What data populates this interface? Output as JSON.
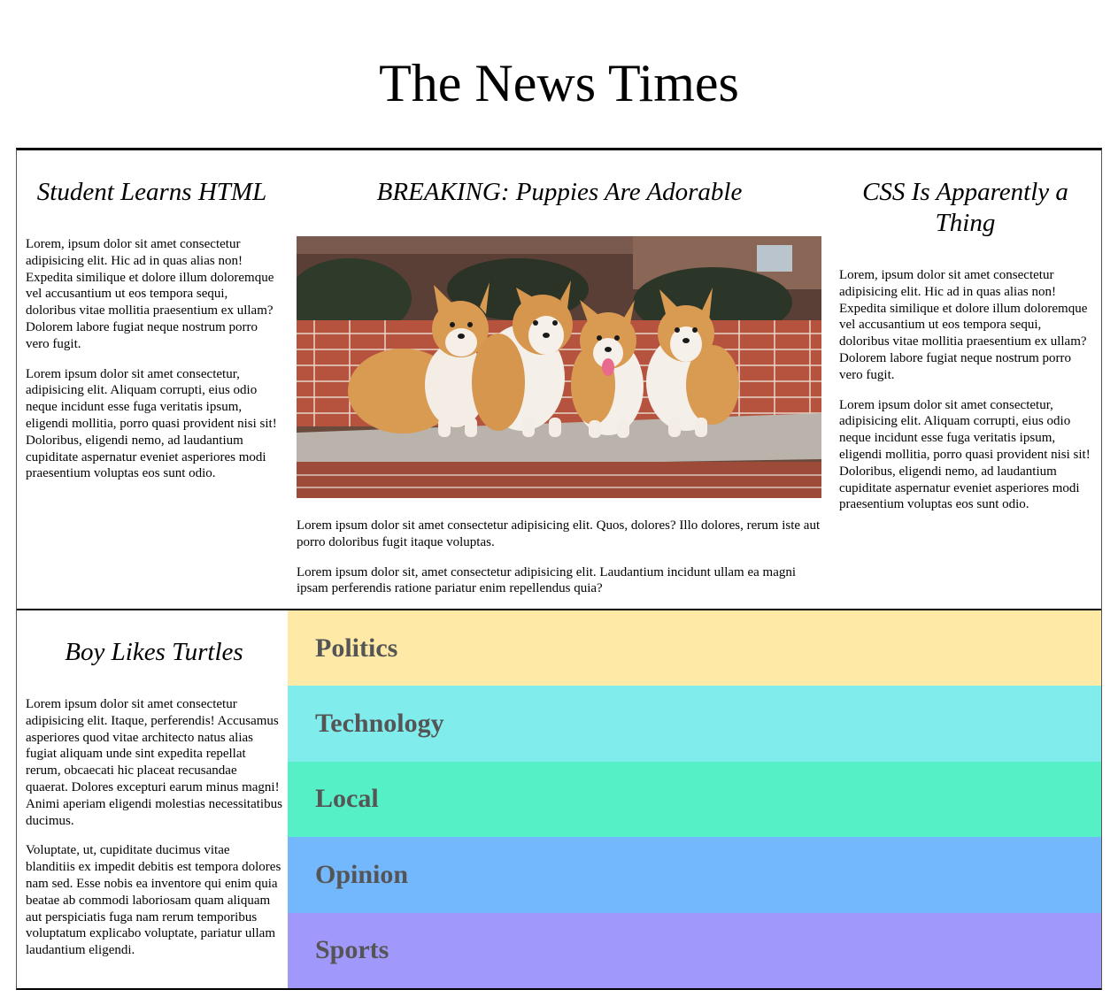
{
  "masthead": {
    "title": "The News Times"
  },
  "articles": {
    "left": {
      "headline": "Student Learns HTML",
      "paragraphs": [
        "Lorem, ipsum dolor sit amet consectetur adipisicing elit. Hic ad in quas alias non! Expedita similique et dolore illum doloremque vel accusantium ut eos tempora sequi, doloribus vitae mollitia praesentium ex ullam? Dolorem labore fugiat neque nostrum porro vero fugit.",
        "Lorem ipsum dolor sit amet consectetur, adipisicing elit. Aliquam corrupti, eius odio neque incidunt esse fuga veritatis ipsum, eligendi mollitia, porro quasi provident nisi sit! Doloribus, eligendi nemo, ad laudantium cupiditate aspernatur eveniet asperiores modi praesentium voluptas eos sunt odio."
      ]
    },
    "middle": {
      "headline": "BREAKING: Puppies Are Adorable",
      "image_subject": "four corgi puppies sitting on a brick ledge",
      "paragraphs": [
        "Lorem ipsum dolor sit amet consectetur adipisicing elit. Quos, dolores? Illo dolores, rerum iste aut porro doloribus fugit itaque voluptas.",
        "Lorem ipsum dolor sit, amet consectetur adipisicing elit. Laudantium incidunt ullam ea magni ipsam perferendis ratione pariatur enim repellendus quia?"
      ]
    },
    "right": {
      "headline": "CSS Is Apparently a Thing",
      "paragraphs": [
        "Lorem, ipsum dolor sit amet consectetur adipisicing elit. Hic ad in quas alias non! Expedita similique et dolore illum doloremque vel accusantium ut eos tempora sequi, doloribus vitae mollitia praesentium ex ullam? Dolorem labore fugiat neque nostrum porro vero fugit.",
        "Lorem ipsum dolor sit amet consectetur, adipisicing elit. Aliquam corrupti, eius odio neque incidunt esse fuga veritatis ipsum, eligendi mollitia, porro quasi provident nisi sit! Doloribus, eligendi nemo, ad laudantium cupiditate aspernatur eveniet asperiores modi praesentium voluptas eos sunt odio."
      ]
    },
    "bottom_left": {
      "headline": "Boy Likes Turtles",
      "paragraphs": [
        "Lorem ipsum dolor sit amet consectetur adipisicing elit. Itaque, perferendis! Accusamus asperiores quod vitae architecto natus alias fugiat aliquam unde sint expedita repellat rerum, obcaecati hic placeat recusandae quaerat. Dolores excepturi earum minus magni! Animi aperiam eligendi molestias necessitatibus ducimus.",
        "Voluptate, ut, cupiditate ducimus vitae blanditiis ex impedit debitis est tempora dolores nam sed. Esse nobis ea inventore qui enim quia beatae ab commodi laboriosam quam aliquam aut perspiciatis fuga nam rerum temporibus voluptatum explicabo voluptate, pariatur ullam laudantium eligendi."
      ]
    }
  },
  "categories": [
    {
      "label": "Politics",
      "color": "#ffe9a6"
    },
    {
      "label": "Technology",
      "color": "#80ecec"
    },
    {
      "label": "Local",
      "color": "#56f0c6"
    },
    {
      "label": "Opinion",
      "color": "#73b7fd"
    },
    {
      "label": "Sports",
      "color": "#a198fb"
    }
  ],
  "colors": {
    "category_text": "#555555",
    "border": "#000000"
  }
}
